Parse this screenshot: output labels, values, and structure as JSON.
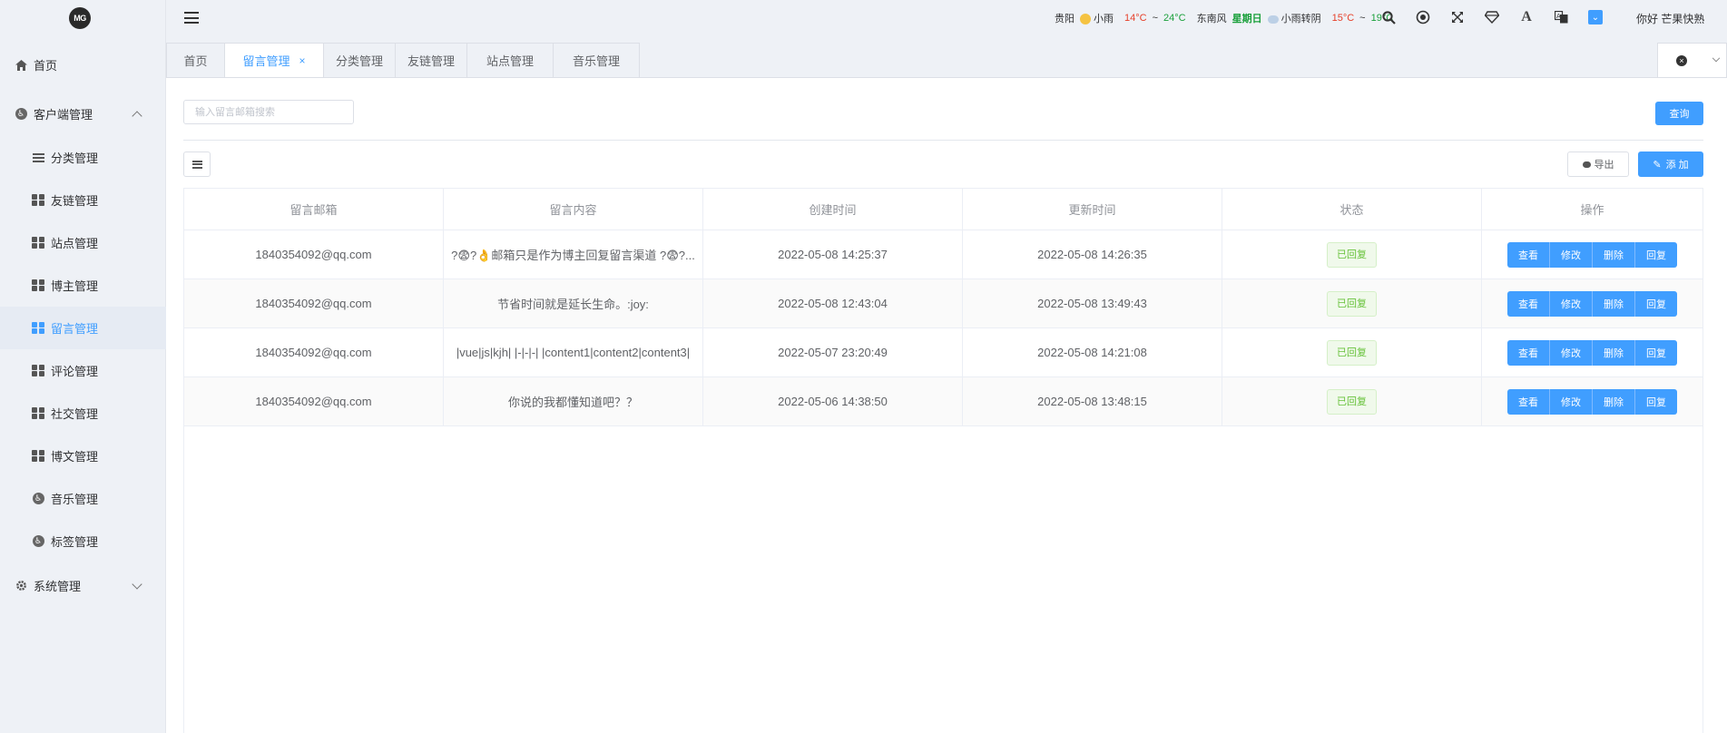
{
  "logo": {
    "text": "MG"
  },
  "sidebar": {
    "items": [
      {
        "label": "首页",
        "icon": "home-icon"
      },
      {
        "label": "客户端管理",
        "icon": "accessibility-icon",
        "expanded": true
      },
      {
        "label": "分类管理",
        "icon": "list-icon"
      },
      {
        "label": "友链管理",
        "icon": "grid-icon"
      },
      {
        "label": "站点管理",
        "icon": "grid-icon"
      },
      {
        "label": "博主管理",
        "icon": "grid-icon"
      },
      {
        "label": "留言管理",
        "icon": "grid-icon",
        "active": true
      },
      {
        "label": "评论管理",
        "icon": "grid-icon"
      },
      {
        "label": "社交管理",
        "icon": "grid-icon"
      },
      {
        "label": "博文管理",
        "icon": "grid-icon"
      },
      {
        "label": "音乐管理",
        "icon": "accessibility-icon"
      },
      {
        "label": "标签管理",
        "icon": "accessibility-icon"
      },
      {
        "label": "系统管理",
        "icon": "gear-icon",
        "expanded": false
      }
    ]
  },
  "header": {
    "weather": {
      "city": "贵阳",
      "today_weather": "小雨",
      "today_temp_low": "14°C",
      "tilde": "~",
      "today_temp_high": "24°C",
      "wind": "东南风",
      "day": "星期日",
      "tomorrow_weather": "小雨转阴",
      "tomorrow_temp_low": "15°C",
      "tomorrow_temp_high": "19°C"
    },
    "greeting": "你好 芒果快熟"
  },
  "tabs": [
    {
      "label": "首页"
    },
    {
      "label": "留言管理",
      "active": true,
      "close": "×"
    },
    {
      "label": "分类管理"
    },
    {
      "label": "友链管理"
    },
    {
      "label": "站点管理"
    },
    {
      "label": "音乐管理"
    }
  ],
  "toolbar": {
    "search_placeholder": "输入留言邮箱搜索",
    "query_label": "查询",
    "export_label": "导出",
    "add_label": "添 加"
  },
  "table": {
    "columns": [
      "留言邮箱",
      "留言内容",
      "创建时间",
      "更新时间",
      "状态",
      "操作"
    ],
    "rows": [
      {
        "email": "1840354092@qq.com",
        "content": "?😨?👌邮箱只是作为博主回复留言渠道 ?😨?...",
        "created": "2022-05-08 14:25:37",
        "updated": "2022-05-08 14:26:35",
        "status": "已回复"
      },
      {
        "email": "1840354092@qq.com",
        "content": "节省时间就是延长生命。:joy:",
        "created": "2022-05-08 12:43:04",
        "updated": "2022-05-08 13:49:43",
        "status": "已回复"
      },
      {
        "email": "1840354092@qq.com",
        "content": "|vue|js|kjh| |-|-|-| |content1|content2|content3|",
        "created": "2022-05-07 23:20:49",
        "updated": "2022-05-08 14:21:08",
        "status": "已回复"
      },
      {
        "email": "1840354092@qq.com",
        "content": "你说的我都懂知道吧？？",
        "created": "2022-05-06 14:38:50",
        "updated": "2022-05-08 13:48:15",
        "status": "已回复"
      }
    ],
    "actions": [
      "查看",
      "修改",
      "删除",
      "回复"
    ]
  },
  "colors": {
    "primary": "#409eff",
    "success": "#67c23a",
    "sidebar_bg": "#eef1f6"
  }
}
